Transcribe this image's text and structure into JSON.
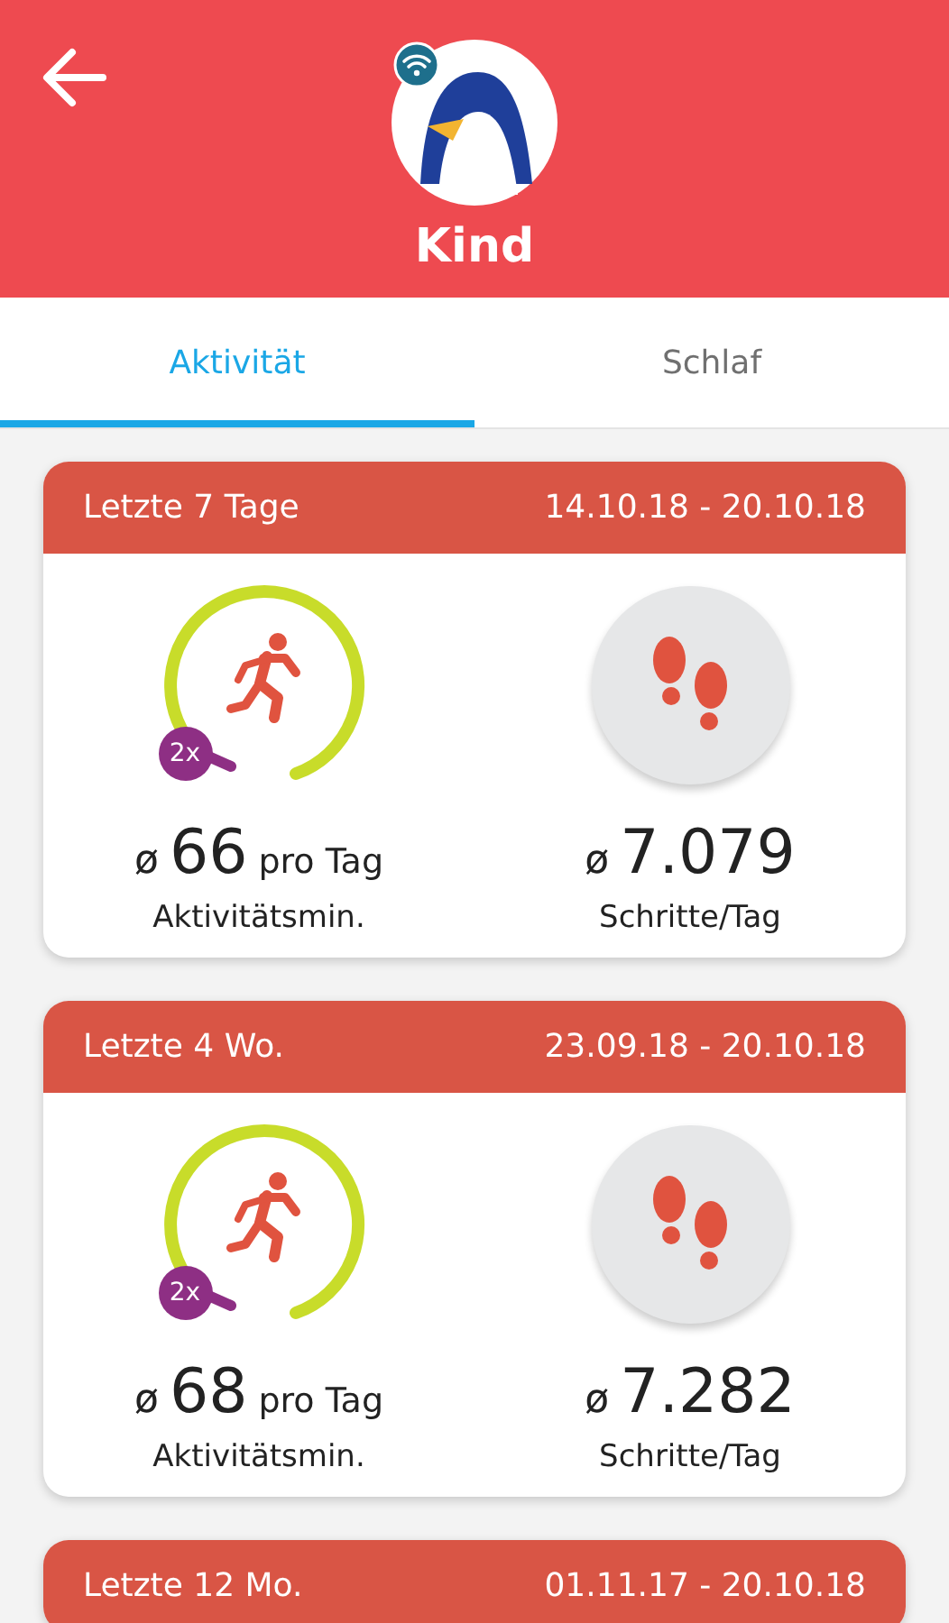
{
  "header": {
    "title": "Kind",
    "online": true
  },
  "tabs": [
    {
      "label": "Aktivität",
      "selected": true
    },
    {
      "label": "Schlaf",
      "selected": false
    }
  ],
  "cards": [
    {
      "period": "Letzte 7 Tage",
      "range": "14.10.18 - 20.10.18",
      "badge": "2x",
      "avg_sign": "ø",
      "minutes": "66",
      "minutes_unit": "pro Tag",
      "minutes_label": "Aktivitätsmin.",
      "steps_sign": "ø",
      "steps": "7.079",
      "steps_label": "Schritte/Tag"
    },
    {
      "period": "Letzte 4 Wo.",
      "range": "23.09.18 - 20.10.18",
      "badge": "2x",
      "avg_sign": "ø",
      "minutes": "68",
      "minutes_unit": "pro Tag",
      "minutes_label": "Aktivitätsmin.",
      "steps_sign": "ø",
      "steps": "7.282",
      "steps_label": "Schritte/Tag"
    },
    {
      "period": "Letzte 12 Mo.",
      "range": "01.11.17 - 20.10.18"
    }
  ]
}
